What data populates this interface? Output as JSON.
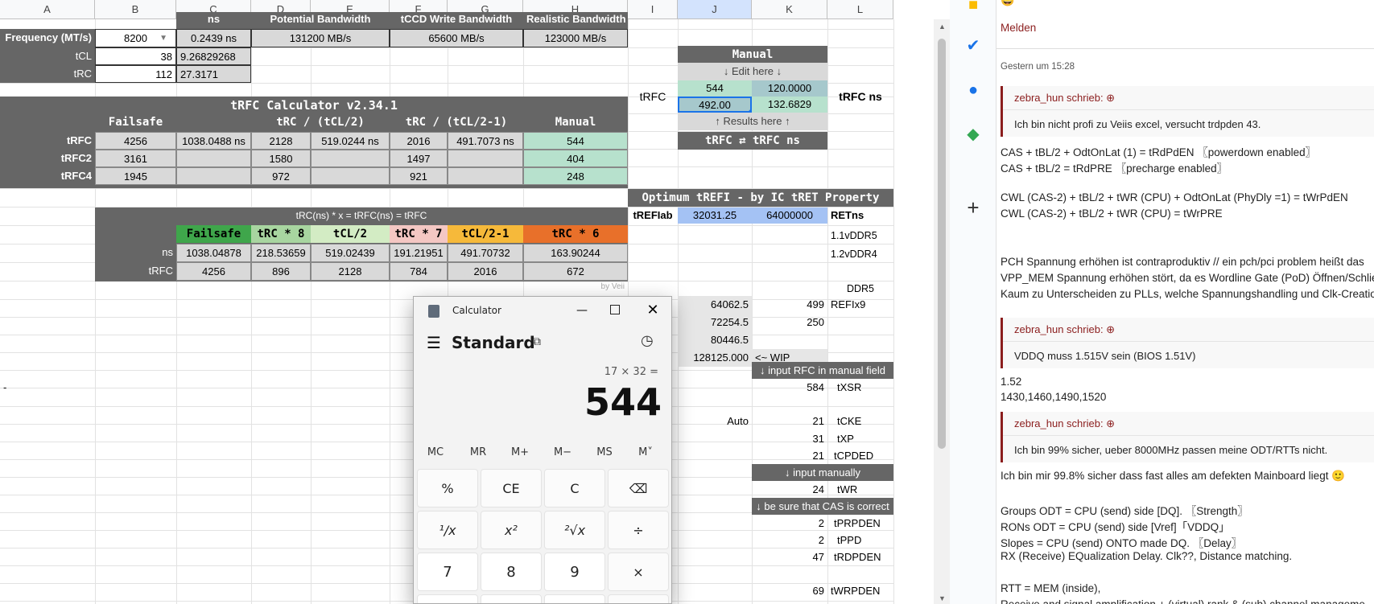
{
  "columns": [
    "A",
    "B",
    "C",
    "D",
    "E",
    "F",
    "G",
    "H",
    "I",
    "J",
    "K",
    "L"
  ],
  "header_row": {
    "ns": "ns",
    "pot": "Potential Bandwidth",
    "tccd": "tCCD Write Bandwidth",
    "real": "Realistic Bandwidth"
  },
  "freq": {
    "label": "Frequency (MT/s)",
    "value": "8200",
    "ns": "0.2439 ns",
    "pot": "131200 MB/s",
    "tccd": "65600 MB/s",
    "real": "123000 MB/s"
  },
  "tcl": {
    "label": "tCL",
    "value": "38",
    "ns": "9.26829268"
  },
  "trc": {
    "label": "tRC",
    "value": "112",
    "ns": "27.3171"
  },
  "calc_title": "tRFC Calculator v2.34.1",
  "calc_heads": [
    "Failsafe",
    "tRC / (tCL/2)",
    "tRC / (tCL/2-1)",
    "Manual"
  ],
  "calc_rows": [
    {
      "label": "tRFC",
      "v1": "4256",
      "v2": "1038.0488 ns",
      "v3": "2128",
      "v4": "519.0244 ns",
      "v5": "2016",
      "v6": "491.7073 ns",
      "man": "544"
    },
    {
      "label": "tRFC2",
      "v1": "3161",
      "v2": "",
      "v3": "1580",
      "v4": "",
      "v5": "1497",
      "v6": "",
      "man": "404"
    },
    {
      "label": "tRFC4",
      "v1": "1945",
      "v2": "",
      "v3": "972",
      "v4": "",
      "v5": "921",
      "v6": "",
      "man": "248"
    }
  ],
  "manual": {
    "title": "Manual",
    "edit": "↓  Edit here  ↓",
    "trfc_label": "tRFC",
    "trfcns_label": "tRFC ns",
    "v544": "544",
    "v120": "120.0000",
    "v492": "492.00",
    "v132": "132.6829",
    "results": "↑  Results here  ↑",
    "swap": "tRFC ⇄ tRFC ns"
  },
  "mult": {
    "formula": "tRC(ns) * x = tRFC(ns) = tRFC",
    "heads": [
      "Failsafe",
      "tRC * 8",
      "tCL/2",
      "tRC * 7",
      "tCL/2-1",
      "tRC * 6"
    ],
    "ns_label": "ns",
    "ns": [
      "1038.04878",
      "218.53659",
      "519.02439",
      "191.21951",
      "491.70732",
      "163.90244"
    ],
    "trfc_label": "tRFC",
    "trfc": [
      "4256",
      "896",
      "2128",
      "784",
      "2016",
      "672"
    ],
    "by": "by Veii"
  },
  "trefi": {
    "title": "Optimum tREFI - by IC tRET Property",
    "label": "tREFIab",
    "v1": "32031.25",
    "v2": "64000000",
    "ret": "RETns",
    "ddr5v": "1.1vDDR5",
    "ddr4v": "1.2vDDR4",
    "ddr5": "DDR5"
  },
  "right_rows": [
    {
      "j": "64062.5",
      "k": "499",
      "l": "REFIx9"
    },
    {
      "j": "72254.5",
      "k": "250",
      "l": ""
    },
    {
      "j": "80446.5",
      "k": "",
      "l": ""
    },
    {
      "j": "128125.000",
      "k": "<~ WIP",
      "l": ""
    }
  ],
  "notes": {
    "input_rfc": "↓ input RFC in manual field",
    "txsr_v": "584",
    "txsr": "tXSR",
    "auto": "Auto",
    "tcke_v": "21",
    "tcke": "tCKE",
    "txp_v": "31",
    "txp": "tXP",
    "tcpded_v": "21",
    "tcpded": "tCPDED",
    "input_manual": "↓ input manually",
    "twr_v": "24",
    "twr": "tWR",
    "be_sure": "↓ be sure that CAS is correct",
    "tprpden_v": "2",
    "tprpden": "tPRPDEN",
    "tppd_v": "2",
    "tppd": "tPPD",
    "trdpden_v": "47",
    "trdpden": "tRDPDEN",
    "twrpden_v": "69",
    "twrpden": "tWRPDEN",
    "dash": "-"
  },
  "calculator": {
    "title": "Calculator",
    "mode": "Standard",
    "expression": "17 × 32 =",
    "result": "544",
    "memory": [
      "MC",
      "MR",
      "M+",
      "M−",
      "MS",
      "M˅"
    ],
    "keys": [
      "%",
      "CE",
      "C",
      "⌫",
      "¹/x",
      "x²",
      "²√x",
      "÷",
      "7",
      "8",
      "9",
      "×"
    ]
  },
  "chat": {
    "report": "Melden",
    "timestamp": "Gestern um 15:28",
    "quote1_head": "zebra_hun schrieb: ⊕",
    "quote1": "Ich bin nicht profi zu Veiis excel, versucht trdpden 43.",
    "lines1": [
      "CAS + tBL/2 + OdtOnLat (1) = tRdPdEN 〖powerdown enabled〗",
      "CAS + tBL/2 = tRdPRE 〖precharge enabled〗",
      "",
      "CWL (CAS-2) + tBL/2 + tWR (CPU) + OdtOnLat (PhyDly =1) = tWrPdEN",
      "CWL (CAS-2) + tBL/2 + tWR (CPU) = tWrPRE",
      "",
      "",
      "PCH Spannung erhöhen ist contraproduktiv // ein pch/pci problem heißt das",
      "VPP_MEM Spannung erhöhen stört, da es Wordline Gate (PoD) Öffnen/Schlie",
      "Kaum zu Unterscheiden zu PLLs, welche Spannungshandling und Clk-Creatio"
    ],
    "quote2_head": "zebra_hun schrieb: ⊕",
    "quote2": "VDDQ muss 1.515V sein (BIOS 1.51V)",
    "lines2": [
      "1.52",
      "1430,1460,1490,1520"
    ],
    "quote3_head": "zebra_hun schrieb: ⊕",
    "quote3": "Ich bin 99% sicher, ueber 8000MHz passen meine ODT/RTTs nicht.",
    "lines3": [
      "Ich bin mir 99.8% sicher dass fast alles am defekten Mainboard liegt 🙂",
      "",
      "Groups ODT = CPU (send) side [DQ].  〖Strength〗",
      "RONs ODT = CPU (send) side [Vref]「VDDQ」",
      "Slopes = CPU (send) ONTO made DQ.  〖Delay〗",
      "RX (Receive) EQualization Delay. Clk??, Distance matching.",
      "",
      "RTT = MEM (inside),",
      "Receive and signal amplification + (virtual) rank & (sub) channel manageme"
    ]
  }
}
